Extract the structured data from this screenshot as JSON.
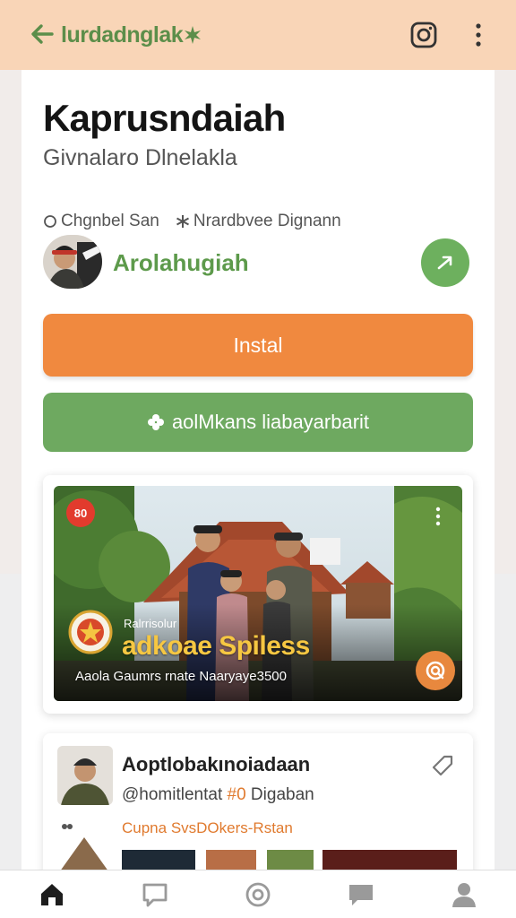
{
  "appbar": {
    "brand": "lurdadnglak",
    "back_icon": "arrow-left-icon",
    "instagram_icon": "instagram-icon",
    "more_icon": "more-vertical-icon"
  },
  "app": {
    "title": "Kaprusndaiah",
    "subtitle": "Givnalaro Dlnelakla",
    "meta_1": "Chgnbel San",
    "meta_2": "Nrardbvee Dignann",
    "developer": "Arolahugiah"
  },
  "buttons": {
    "install": "Instal",
    "secondary": "aolMkans liabayarbarit"
  },
  "feature": {
    "badge": "80",
    "small_text": "Ralrrisolur",
    "headline": "adkoae Spiless",
    "caption": "Aaola Gaumrs rnate Naaryaye3500"
  },
  "post": {
    "title": "Aoptlobakınoiadaan",
    "tag_prefix": "@homitlentat ",
    "tag_highlight": "#0",
    "tag_suffix": " Digaban",
    "link": "Cupna SvsDOkers-Rstan"
  },
  "nav": [
    "home-icon",
    "chat-bubble-icon",
    "at-sign-icon",
    "message-icon",
    "profile-icon"
  ],
  "colors": {
    "appbar": "#f9d5b7",
    "brand_green": "#5c8e4a",
    "install_orange": "#f0893f",
    "secondary_green": "#6ea960"
  }
}
